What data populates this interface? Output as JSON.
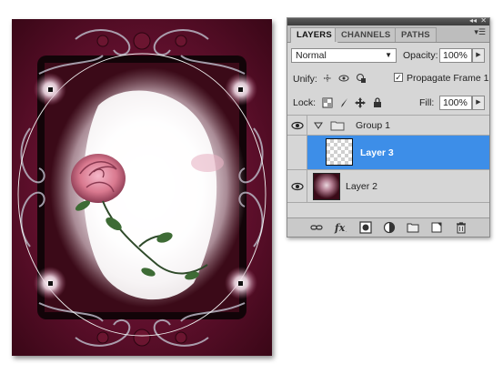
{
  "panel": {
    "tabs": [
      {
        "label": "LAYERS",
        "active": true
      },
      {
        "label": "CHANNELS",
        "active": false
      },
      {
        "label": "PATHS",
        "active": false
      }
    ],
    "blend_mode": "Normal",
    "opacity_label": "Opacity:",
    "opacity_value": "100%",
    "unify_label": "Unify:",
    "propagate_label": "Propagate Frame 1",
    "propagate_checked": true,
    "lock_label": "Lock:",
    "fill_label": "Fill:",
    "fill_value": "100%",
    "layers": [
      {
        "name": "Group 1",
        "type": "group",
        "visible": true,
        "expanded": true,
        "selected": false
      },
      {
        "name": "Layer 3",
        "type": "layer",
        "visible": false,
        "selected": true,
        "thumbnail": "transparent"
      },
      {
        "name": "Layer 2",
        "type": "layer",
        "visible": true,
        "selected": false,
        "thumbnail": "image"
      }
    ],
    "bottom_icons": [
      "link-icon",
      "fx-icon",
      "mask-icon",
      "adjustment-icon",
      "folder-icon",
      "new-layer-icon",
      "trash-icon"
    ]
  },
  "colors": {
    "selection": "#3d8ee8",
    "canvas_bg": "#5a0f2a"
  }
}
